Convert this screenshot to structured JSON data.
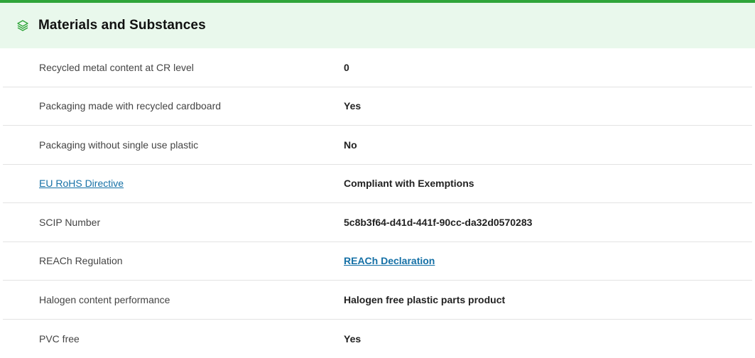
{
  "section": {
    "title": "Materials and Substances",
    "icon": "layers-icon",
    "accent_color": "#2fa53a",
    "header_bg": "#e9f8ec",
    "link_color": "#1570a6"
  },
  "rows": [
    {
      "label": "Recycled metal content at CR level",
      "value": "0"
    },
    {
      "label": "Packaging made with recycled cardboard",
      "value": "Yes"
    },
    {
      "label": "Packaging without single use plastic",
      "value": "No"
    },
    {
      "label": "EU RoHS Directive",
      "value": "Compliant with Exemptions"
    },
    {
      "label": "SCIP Number",
      "value": "5c8b3f64-d41d-441f-90cc-da32d0570283"
    },
    {
      "label": "REACh Regulation",
      "value": "REACh Declaration"
    },
    {
      "label": "Halogen content performance",
      "value": "Halogen free plastic parts product"
    },
    {
      "label": "PVC free",
      "value": "Yes"
    }
  ]
}
